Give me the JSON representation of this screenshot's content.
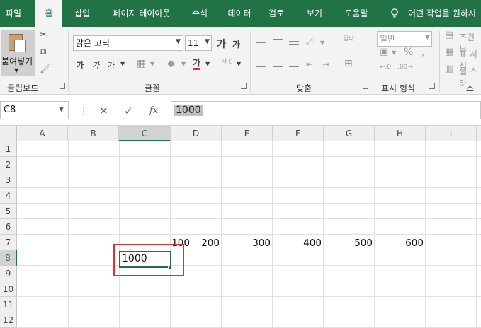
{
  "tabs": [
    "파일",
    "홈",
    "삽입",
    "페이지 레이아웃",
    "수식",
    "데이터",
    "검토",
    "보기",
    "도움말"
  ],
  "tell_me": "어떤 작업을 원하시",
  "clipboard": {
    "paste_label": "붙여넣기",
    "group_label": "클립보드"
  },
  "font": {
    "name": "맑은 고딕",
    "size": "11",
    "group_label": "글꼴",
    "bold": "가",
    "italic": "가",
    "underline": "가",
    "grow": "가",
    "shrink": "가",
    "color_glyph": "가",
    "phonetic": "내천"
  },
  "alignment": {
    "group_label": "맞춤",
    "wrap": "갑나"
  },
  "number": {
    "format": "일반",
    "group_label": "표시 형식"
  },
  "styles": {
    "conditional": "조건부",
    "table": "표 서식",
    "cell": "셀 스타",
    "group_label": "스타"
  },
  "formula_bar": {
    "name_box": "C8",
    "value": "1000",
    "fx": "fx"
  },
  "columns": [
    "A",
    "B",
    "C",
    "D",
    "E",
    "F",
    "G",
    "H",
    "I"
  ],
  "rows": [
    "1",
    "2",
    "3",
    "4",
    "5",
    "6",
    "7",
    "8",
    "9",
    "10",
    "11",
    "12"
  ],
  "cells": {
    "C7": "100",
    "D7": "200",
    "E7": "300",
    "F7": "400",
    "G7": "500",
    "H7": "600",
    "C8": "1000"
  },
  "colors": {
    "brand": "#217346",
    "highlight": "#e03131"
  }
}
